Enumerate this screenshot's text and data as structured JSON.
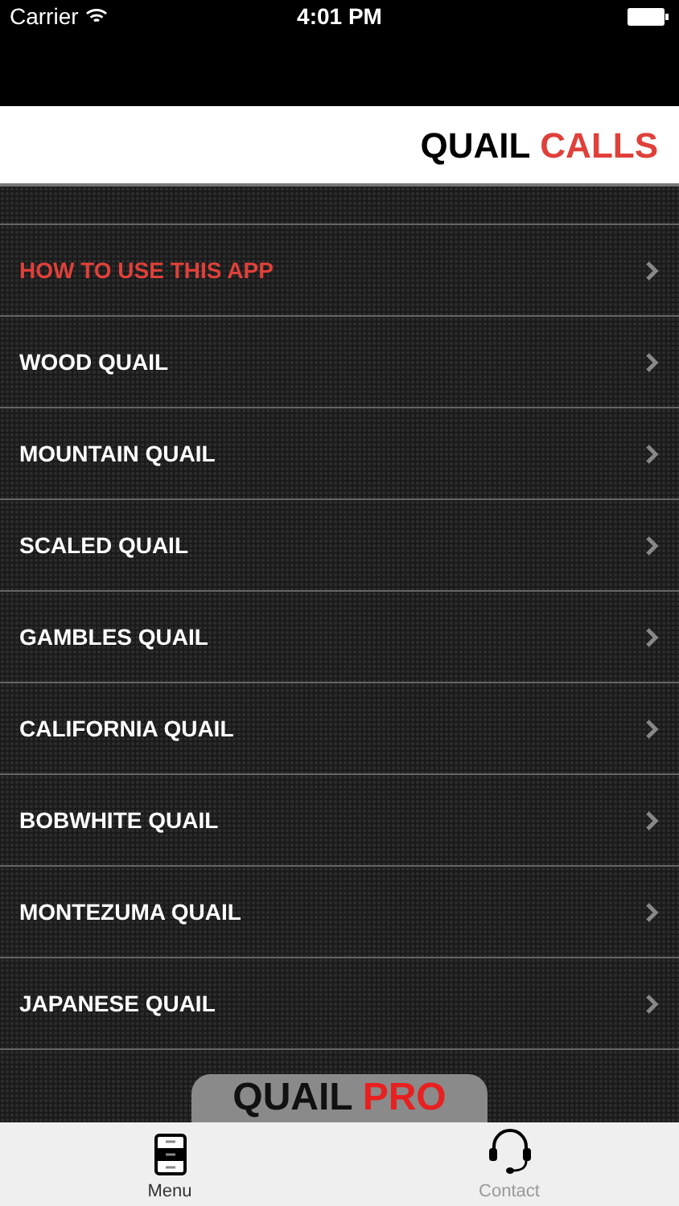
{
  "status_bar": {
    "carrier": "Carrier",
    "time": "4:01 PM"
  },
  "header": {
    "title_dark": "QUAIL",
    "title_accent": "CALLS"
  },
  "menu": [
    {
      "label": "HOW TO USE THIS APP",
      "highlighted": true
    },
    {
      "label": "WOOD QUAIL",
      "highlighted": false
    },
    {
      "label": "MOUNTAIN QUAIL",
      "highlighted": false
    },
    {
      "label": "SCALED QUAIL",
      "highlighted": false
    },
    {
      "label": "GAMBLES QUAIL",
      "highlighted": false
    },
    {
      "label": "CALIFORNIA QUAIL",
      "highlighted": false
    },
    {
      "label": "BOBWHITE QUAIL",
      "highlighted": false
    },
    {
      "label": "MONTEZUMA QUAIL",
      "highlighted": false
    },
    {
      "label": "JAPANESE QUAIL",
      "highlighted": false
    }
  ],
  "banner": {
    "word_dark": "QUAIL",
    "word_accent": "PRO"
  },
  "tab_bar": [
    {
      "label": "Menu",
      "kind": "cabinet",
      "selected": true
    },
    {
      "label": "Contact",
      "kind": "headset",
      "selected": false
    }
  ]
}
